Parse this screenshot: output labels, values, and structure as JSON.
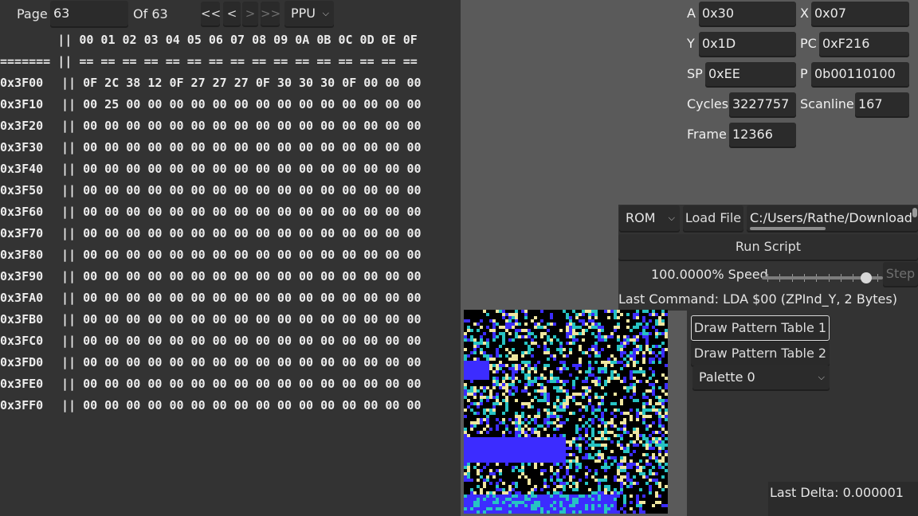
{
  "memory": {
    "page_label": "Page",
    "page_value": "63",
    "of_label": "Of 63",
    "nav": [
      "<<",
      "<",
      ">",
      ">>"
    ],
    "source": "PPU",
    "header": "        || 00 01 02 03 04 05 06 07 08 09 0A 0B 0C 0D 0E 0F",
    "divider": "======= || == == == == == == == == == == == == == == == ==",
    "rows": [
      {
        "addr": "0x3F00",
        "bytes": "|| 0F 2C 38 12 0F 27 27 27 0F 30 30 30 0F 00 00 00"
      },
      {
        "addr": "0x3F10",
        "bytes": "|| 00 25 00 00 00 00 00 00 00 00 00 00 00 00 00 00"
      },
      {
        "addr": "0x3F20",
        "bytes": "|| 00 00 00 00 00 00 00 00 00 00 00 00 00 00 00 00"
      },
      {
        "addr": "0x3F30",
        "bytes": "|| 00 00 00 00 00 00 00 00 00 00 00 00 00 00 00 00"
      },
      {
        "addr": "0x3F40",
        "bytes": "|| 00 00 00 00 00 00 00 00 00 00 00 00 00 00 00 00"
      },
      {
        "addr": "0x3F50",
        "bytes": "|| 00 00 00 00 00 00 00 00 00 00 00 00 00 00 00 00"
      },
      {
        "addr": "0x3F60",
        "bytes": "|| 00 00 00 00 00 00 00 00 00 00 00 00 00 00 00 00"
      },
      {
        "addr": "0x3F70",
        "bytes": "|| 00 00 00 00 00 00 00 00 00 00 00 00 00 00 00 00"
      },
      {
        "addr": "0x3F80",
        "bytes": "|| 00 00 00 00 00 00 00 00 00 00 00 00 00 00 00 00"
      },
      {
        "addr": "0x3F90",
        "bytes": "|| 00 00 00 00 00 00 00 00 00 00 00 00 00 00 00 00"
      },
      {
        "addr": "0x3FA0",
        "bytes": "|| 00 00 00 00 00 00 00 00 00 00 00 00 00 00 00 00"
      },
      {
        "addr": "0x3FB0",
        "bytes": "|| 00 00 00 00 00 00 00 00 00 00 00 00 00 00 00 00"
      },
      {
        "addr": "0x3FC0",
        "bytes": "|| 00 00 00 00 00 00 00 00 00 00 00 00 00 00 00 00"
      },
      {
        "addr": "0x3FD0",
        "bytes": "|| 00 00 00 00 00 00 00 00 00 00 00 00 00 00 00 00"
      },
      {
        "addr": "0x3FE0",
        "bytes": "|| 00 00 00 00 00 00 00 00 00 00 00 00 00 00 00 00"
      },
      {
        "addr": "0x3FF0",
        "bytes": "|| 00 00 00 00 00 00 00 00 00 00 00 00 00 00 00 00"
      }
    ]
  },
  "registers": {
    "a_label": "A",
    "a": "0x30",
    "x_label": "X",
    "x": "0x07",
    "y_label": "Y",
    "y": "0x1D",
    "pc_label": "PC",
    "pc": "0xF216",
    "sp_label": "SP",
    "sp": "0xEE",
    "p_label": "P",
    "p": "0b00110100",
    "cycles_label": "Cycles",
    "cycles": "3227757",
    "scanline_label": "Scanline",
    "scanline": "167",
    "frame_label": "Frame",
    "frame": "12366"
  },
  "controls": {
    "file_type": "ROM",
    "load_file": "Load File",
    "path": "C:/Users/Rathe/Download",
    "run_script": "Run Script",
    "speed_label": "100.0000% Speed",
    "speed_fraction": 0.9,
    "step": "Step",
    "last_command": "Last Command: LDA $00 (ZPInd_Y, 2 Bytes)"
  },
  "pattern": {
    "draw_table_1": "Draw Pattern Table 1",
    "draw_table_2": "Draw Pattern Table 2",
    "palette": "Palette 0",
    "colors": [
      "#000000",
      "#3c2cff",
      "#27c3c3",
      "#f0e6a0"
    ]
  },
  "last_delta": "Last Delta: 0.000001"
}
